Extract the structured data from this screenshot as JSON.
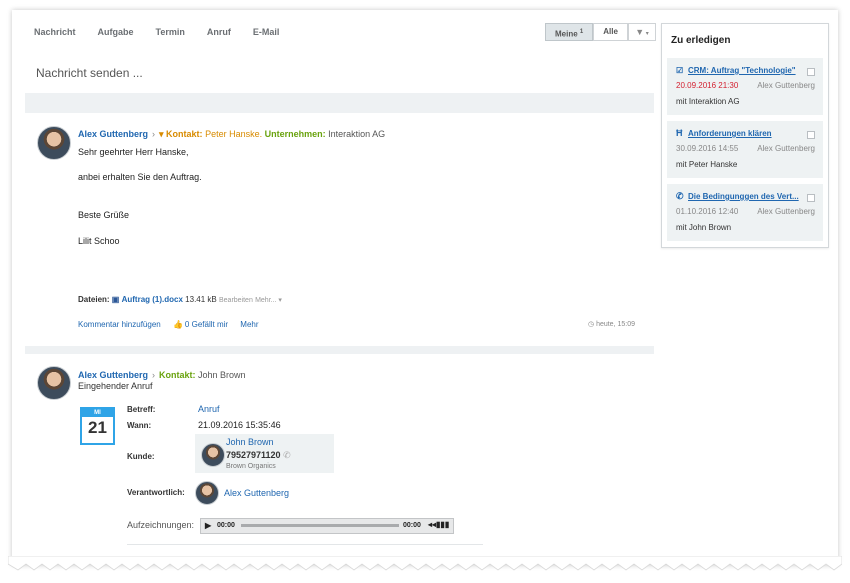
{
  "tabs": [
    "Nachricht",
    "Aufgabe",
    "Termin",
    "Anruf",
    "E-Mail"
  ],
  "filters": {
    "mine": "Meine",
    "mine_count": "1",
    "all": "Alle"
  },
  "composer": {
    "placeholder": "Nachricht senden ..."
  },
  "post1": {
    "author": "Alex Guttenberg",
    "contact_label": "Kontakt:",
    "contact_value": "Peter Hanske.",
    "company_label": "Unternehmen:",
    "company_value": "Interaktion AG",
    "lines": [
      "Sehr geehrter Herr Hanske,",
      "anbei erhalten Sie den Auftrag.",
      "Beste Grüße",
      "Lilit Schoo"
    ],
    "files_label": "Dateien:",
    "file_name": "Auftrag (1).docx",
    "file_size": "13.41 kB",
    "file_edit": "Bearbeiten",
    "file_more": "Mehr...",
    "comment": "Kommentar hinzufügen",
    "likes": "0 Gefällt mir",
    "more": "Mehr",
    "time": "heute, 15:09"
  },
  "post2": {
    "author": "Alex Guttenberg",
    "contact_label": "Kontakt:",
    "contact_value": "John Brown",
    "subtitle": "Eingehender Anruf",
    "cal_weekday": "MI",
    "cal_day": "21",
    "subject_label": "Betreff:",
    "subject_value": "Anruf",
    "when_label": "Wann:",
    "when_value": "21.09.2016 15:35:46",
    "client_label": "Kunde:",
    "client_name": "John Brown",
    "client_phone": "79527971120",
    "client_company": "Brown Organics",
    "resp_label": "Verantwortlich:",
    "resp_name": "Alex Guttenberg",
    "rec_label": "Aufzeichnungen:",
    "rec_start": "00:00",
    "rec_end": "00:00"
  },
  "sidebar": {
    "title": "Zu erledigen",
    "tasks": [
      {
        "title": "CRM: Auftrag \"Technologie\"",
        "date": "20.09.2016 21:30",
        "responsible": "Alex Guttenberg",
        "with": "mit Interaktion AG",
        "icon": "checkbox-icon"
      },
      {
        "title": "Anforderungen klären",
        "date": "30.09.2016 14:55",
        "responsible": "Alex Guttenberg",
        "with": "mit Peter Hanske",
        "icon": "meeting-icon"
      },
      {
        "title": "Die Bedingunggen des Vert...",
        "date": "01.10.2016 12:40",
        "responsible": "Alex Guttenberg",
        "with": "mit John Brown",
        "icon": "phone-icon"
      }
    ]
  },
  "colors": {
    "link": "#2067b0",
    "orange": "#d88b00",
    "green": "#6aa30f",
    "red": "#d31f2f",
    "calendar": "#2fa4e7"
  }
}
